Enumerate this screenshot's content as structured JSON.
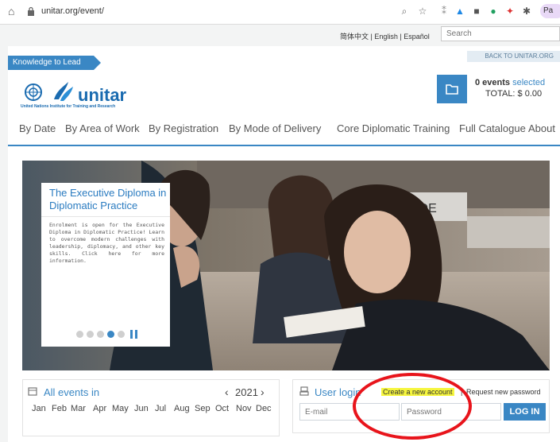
{
  "browser": {
    "url": "unitar.org/event/",
    "profile_label": "Pa"
  },
  "top": {
    "languages": "简体中文 | English | Español",
    "search_placeholder": "Search",
    "tagline": "Knowledge to Lead",
    "back_link": "BACK TO UNITAR.ORG"
  },
  "logo": {
    "name": "unitar",
    "subtitle": "United Nations Institute for Training and Research"
  },
  "cart": {
    "events_count": "0 events",
    "events_suffix": "selected",
    "total": "TOTAL: $ 0.00"
  },
  "nav": {
    "items": [
      "By Date",
      "By Area of Work",
      "By Registration",
      "By Mode of Delivery",
      "Core Diplomatic Training",
      "Full Catalogue",
      "About"
    ]
  },
  "hero": {
    "title": "The Executive Diploma in Diplomatic Practice",
    "body": "Enrolment is open for the Executive Diploma in Diplomatic Practice! Learn to overcome modern challenges with leadership, diplomacy, and other key skills. Click here for more information.",
    "slide_count": 5,
    "active_slide": 4
  },
  "calendar": {
    "title": "All events in",
    "year": "2021",
    "prev": "‹",
    "next": "›",
    "months": [
      "Jan",
      "Feb",
      "Mar",
      "Apr",
      "May",
      "Jun",
      "Jul",
      "Aug",
      "Sep",
      "Oct",
      "Nov",
      "Dec"
    ]
  },
  "login": {
    "title": "User login",
    "create_account": "Create a new account",
    "separator": "|",
    "request_password": "Request new password",
    "email_placeholder": "E-mail",
    "password_placeholder": "Password",
    "login_button": "LOG IN"
  },
  "colors": {
    "accent": "#3a87c4",
    "highlight": "#f6f63e",
    "annotation": "#e8141b"
  }
}
